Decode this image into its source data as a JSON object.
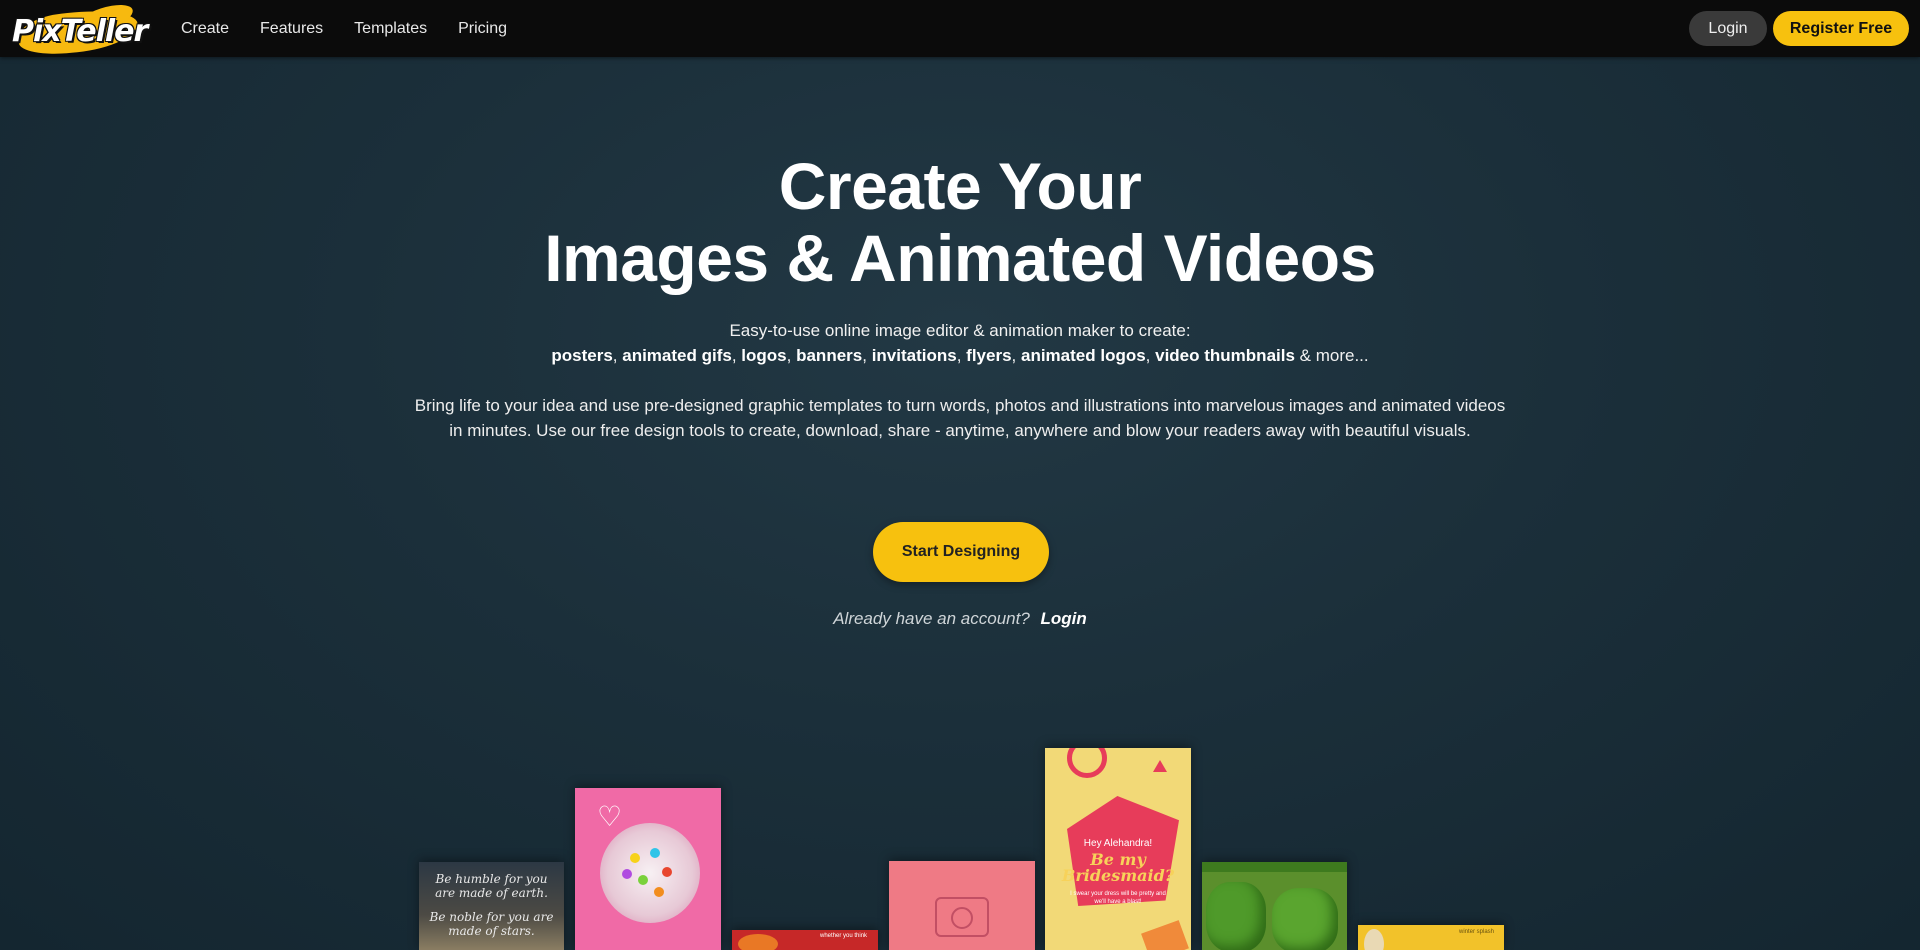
{
  "brand": {
    "logo_text": "PixTeller",
    "accent_color": "#f7c10e"
  },
  "nav": {
    "links": [
      "Create",
      "Features",
      "Templates",
      "Pricing"
    ],
    "login_label": "Login",
    "register_label": "Register Free"
  },
  "hero": {
    "title_line1": "Create Your",
    "title_line2": "Images & Animated Videos",
    "subtitle": "Easy-to-use online image editor & animation maker to create:",
    "features": [
      "posters",
      "animated gifs",
      "logos",
      "banners",
      "invitations",
      "flyers",
      "animated logos",
      "video thumbnails"
    ],
    "features_suffix": "& more...",
    "paragraph": "Bring life to your idea and use pre-designed graphic templates to turn words, photos and illustrations into marvelous images and animated videos in minutes. Use our free design tools to create, download, share - anytime, anywhere and blow your readers away with beautiful visuals.",
    "cta_label": "Start Designing",
    "account_prompt": "Already have an account?",
    "account_login": "Login"
  },
  "templates": {
    "card1_text1": "Be humble for you are made of earth.",
    "card1_text2": "Be noble for you are made of stars.",
    "card3_text": "whether you think",
    "card5_greeting": "Hey Alehandra!",
    "card5_title_line1": "Be my",
    "card5_title_line2": "Bridesmaid?",
    "card5_fine_print": "I swear your dress will be pretty and we'll have a blast!",
    "card7_text": "winter splash"
  }
}
